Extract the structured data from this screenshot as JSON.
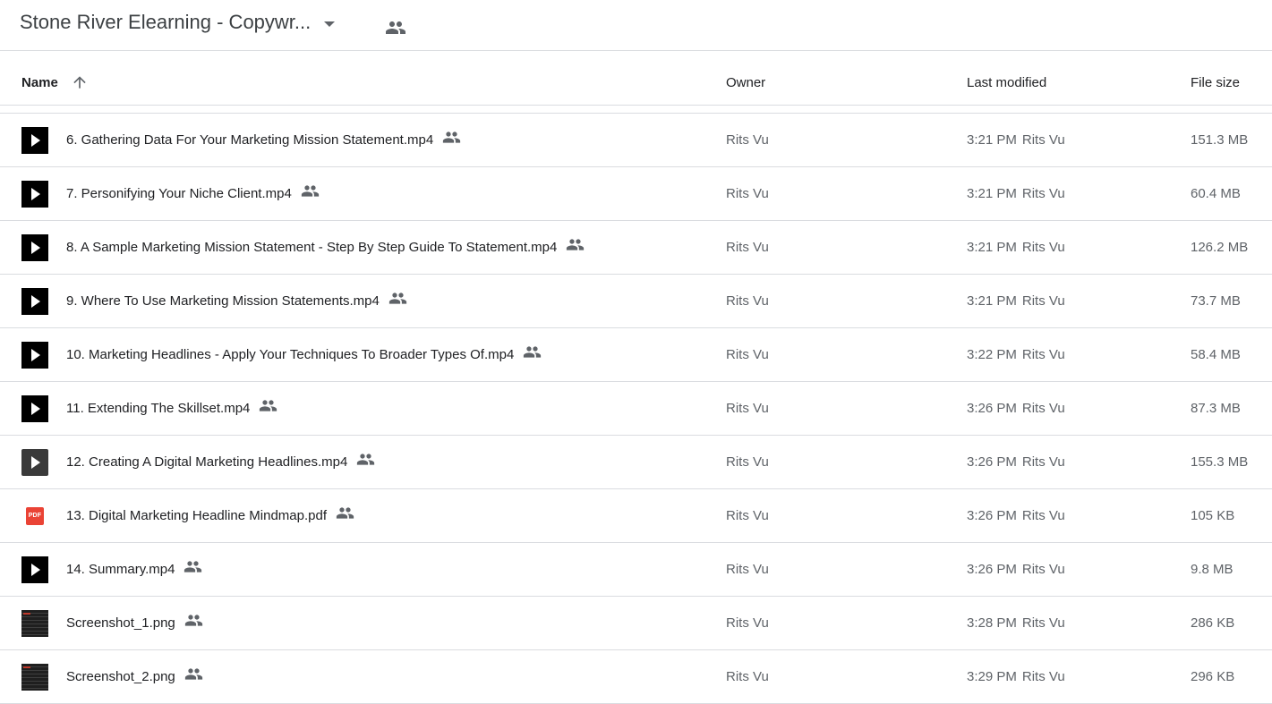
{
  "folder": {
    "title": "Stone River Elearning - Copywr...",
    "icons": {
      "dropdown": "arrow-drop-down-icon",
      "shared": "people-icon"
    }
  },
  "columns": {
    "name": "Name",
    "owner": "Owner",
    "last_modified": "Last modified",
    "file_size": "File size",
    "sort_direction": "ascending"
  },
  "files": [
    {
      "name": "6. Gathering Data For Your Marketing Mission Statement.mp4",
      "type": "video",
      "owner": "Rits Vu",
      "modified_time": "3:21 PM",
      "modified_by": "Rits Vu",
      "size": "151.3 MB"
    },
    {
      "name": "7. Personifying Your Niche Client.mp4",
      "type": "video",
      "owner": "Rits Vu",
      "modified_time": "3:21 PM",
      "modified_by": "Rits Vu",
      "size": "60.4 MB"
    },
    {
      "name": "8. A Sample Marketing Mission Statement - Step By Step Guide To Statement.mp4",
      "type": "video",
      "owner": "Rits Vu",
      "modified_time": "3:21 PM",
      "modified_by": "Rits Vu",
      "size": "126.2 MB"
    },
    {
      "name": "9. Where To Use Marketing Mission Statements.mp4",
      "type": "video",
      "owner": "Rits Vu",
      "modified_time": "3:21 PM",
      "modified_by": "Rits Vu",
      "size": "73.7 MB"
    },
    {
      "name": "10. Marketing Headlines - Apply Your Techniques To Broader Types Of.mp4",
      "type": "video",
      "owner": "Rits Vu",
      "modified_time": "3:22 PM",
      "modified_by": "Rits Vu",
      "size": "58.4 MB"
    },
    {
      "name": "11. Extending The Skillset.mp4",
      "type": "video",
      "owner": "Rits Vu",
      "modified_time": "3:26 PM",
      "modified_by": "Rits Vu",
      "size": "87.3 MB"
    },
    {
      "name": "12. Creating A Digital Marketing Headlines.mp4",
      "type": "video-gray",
      "owner": "Rits Vu",
      "modified_time": "3:26 PM",
      "modified_by": "Rits Vu",
      "size": "155.3 MB"
    },
    {
      "name": "13. Digital Marketing Headline Mindmap.pdf",
      "type": "pdf",
      "owner": "Rits Vu",
      "modified_time": "3:26 PM",
      "modified_by": "Rits Vu",
      "size": "105 KB"
    },
    {
      "name": "14. Summary.mp4",
      "type": "video",
      "owner": "Rits Vu",
      "modified_time": "3:26 PM",
      "modified_by": "Rits Vu",
      "size": "9.8 MB"
    },
    {
      "name": "Screenshot_1.png",
      "type": "image",
      "owner": "Rits Vu",
      "modified_time": "3:28 PM",
      "modified_by": "Rits Vu",
      "size": "286 KB"
    },
    {
      "name": "Screenshot_2.png",
      "type": "image",
      "owner": "Rits Vu",
      "modified_time": "3:29 PM",
      "modified_by": "Rits Vu",
      "size": "296 KB"
    }
  ],
  "pdf_badge": "PDF",
  "colors": {
    "pdf": "#ea4335",
    "divider": "#dadce0",
    "secondary_text": "#5f6368"
  }
}
